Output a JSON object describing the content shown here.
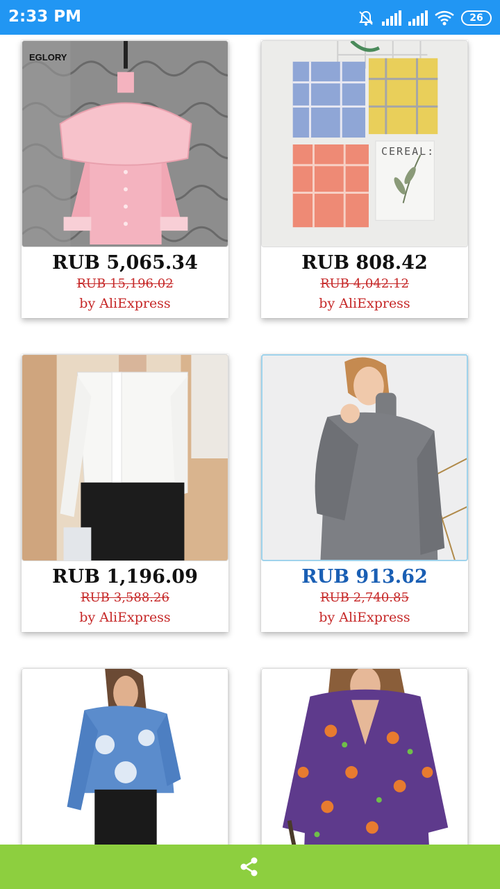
{
  "status_bar": {
    "time": "2:33 PM",
    "battery": "26",
    "icons": [
      "muted-bell-icon",
      "signal-icon",
      "signal-icon",
      "wifi-icon",
      "battery-icon"
    ]
  },
  "products": [
    {
      "price": "RUB 5,065.34",
      "old_price": "RUB 15,196.02",
      "seller": "by AliExpress",
      "image": "pink-ruffle-blouse",
      "image_text": "EGLORY"
    },
    {
      "price": "RUB 808.42",
      "old_price": "RUB 4,042.12",
      "seller": "by AliExpress",
      "image": "plaid-shirts",
      "image_text": "CEREAL:"
    },
    {
      "price": "RUB 1,196.09",
      "old_price": "RUB 3,588.26",
      "seller": "by AliExpress",
      "image": "white-blouse"
    },
    {
      "price": "RUB 913.62",
      "old_price": "RUB 2,740.85",
      "seller": "by AliExpress",
      "image": "gray-turtleneck",
      "selected": true
    },
    {
      "image": "denim-tie-dye-shirt"
    },
    {
      "image": "purple-sloth-print-blouse"
    }
  ],
  "bottom_bar": {
    "icon": "share-icon"
  },
  "colors": {
    "status_bar": "#2196f3",
    "bottom_bar": "#8dcf3f",
    "price_active": "#1a5fb4",
    "old_price": "#c62828",
    "seller": "#c62828"
  }
}
